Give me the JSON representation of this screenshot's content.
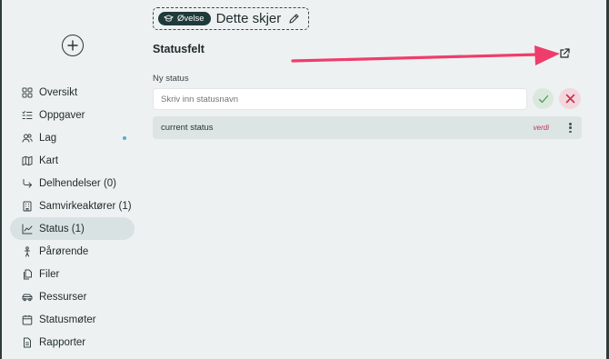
{
  "sidebar": {
    "items": [
      {
        "label": "Oversikt",
        "icon": "grid-icon",
        "active": false
      },
      {
        "label": "Oppgaver",
        "icon": "checklist-icon",
        "active": false
      },
      {
        "label": "Lag",
        "icon": "users-icon",
        "active": false,
        "notification_dot": true
      },
      {
        "label": "Kart",
        "icon": "map-icon",
        "active": false
      },
      {
        "label": "Delhendelser (0)",
        "icon": "subdirectory-arrow-icon",
        "active": false
      },
      {
        "label": "Samvirkeaktører (1)",
        "icon": "building-icon",
        "active": false
      },
      {
        "label": "Status (1)",
        "icon": "chart-line-icon",
        "active": true
      },
      {
        "label": "Pårørende",
        "icon": "person-icon",
        "active": false
      },
      {
        "label": "Filer",
        "icon": "files-icon",
        "active": false
      },
      {
        "label": "Ressurser",
        "icon": "vehicle-icon",
        "active": false
      },
      {
        "label": "Statusmøter",
        "icon": "calendar-icon",
        "active": false
      },
      {
        "label": "Rapporter",
        "icon": "document-icon",
        "active": false
      }
    ]
  },
  "header": {
    "badge": "Øvelse",
    "title": "Dette skjer"
  },
  "section": {
    "title": "Statusfelt"
  },
  "new_status": {
    "label": "Ny status",
    "placeholder": "Skriv inn statusnavn",
    "value": ""
  },
  "statuses": [
    {
      "name": "current status",
      "value_label": "verdi"
    }
  ],
  "colors": {
    "accent_dark": "#1f3a3a",
    "active_nav": "#d9e2e2",
    "confirm_bg": "#dbe9dd",
    "cancel_bg": "#f2d7dd",
    "annotation_arrow": "#ee3d6c"
  }
}
